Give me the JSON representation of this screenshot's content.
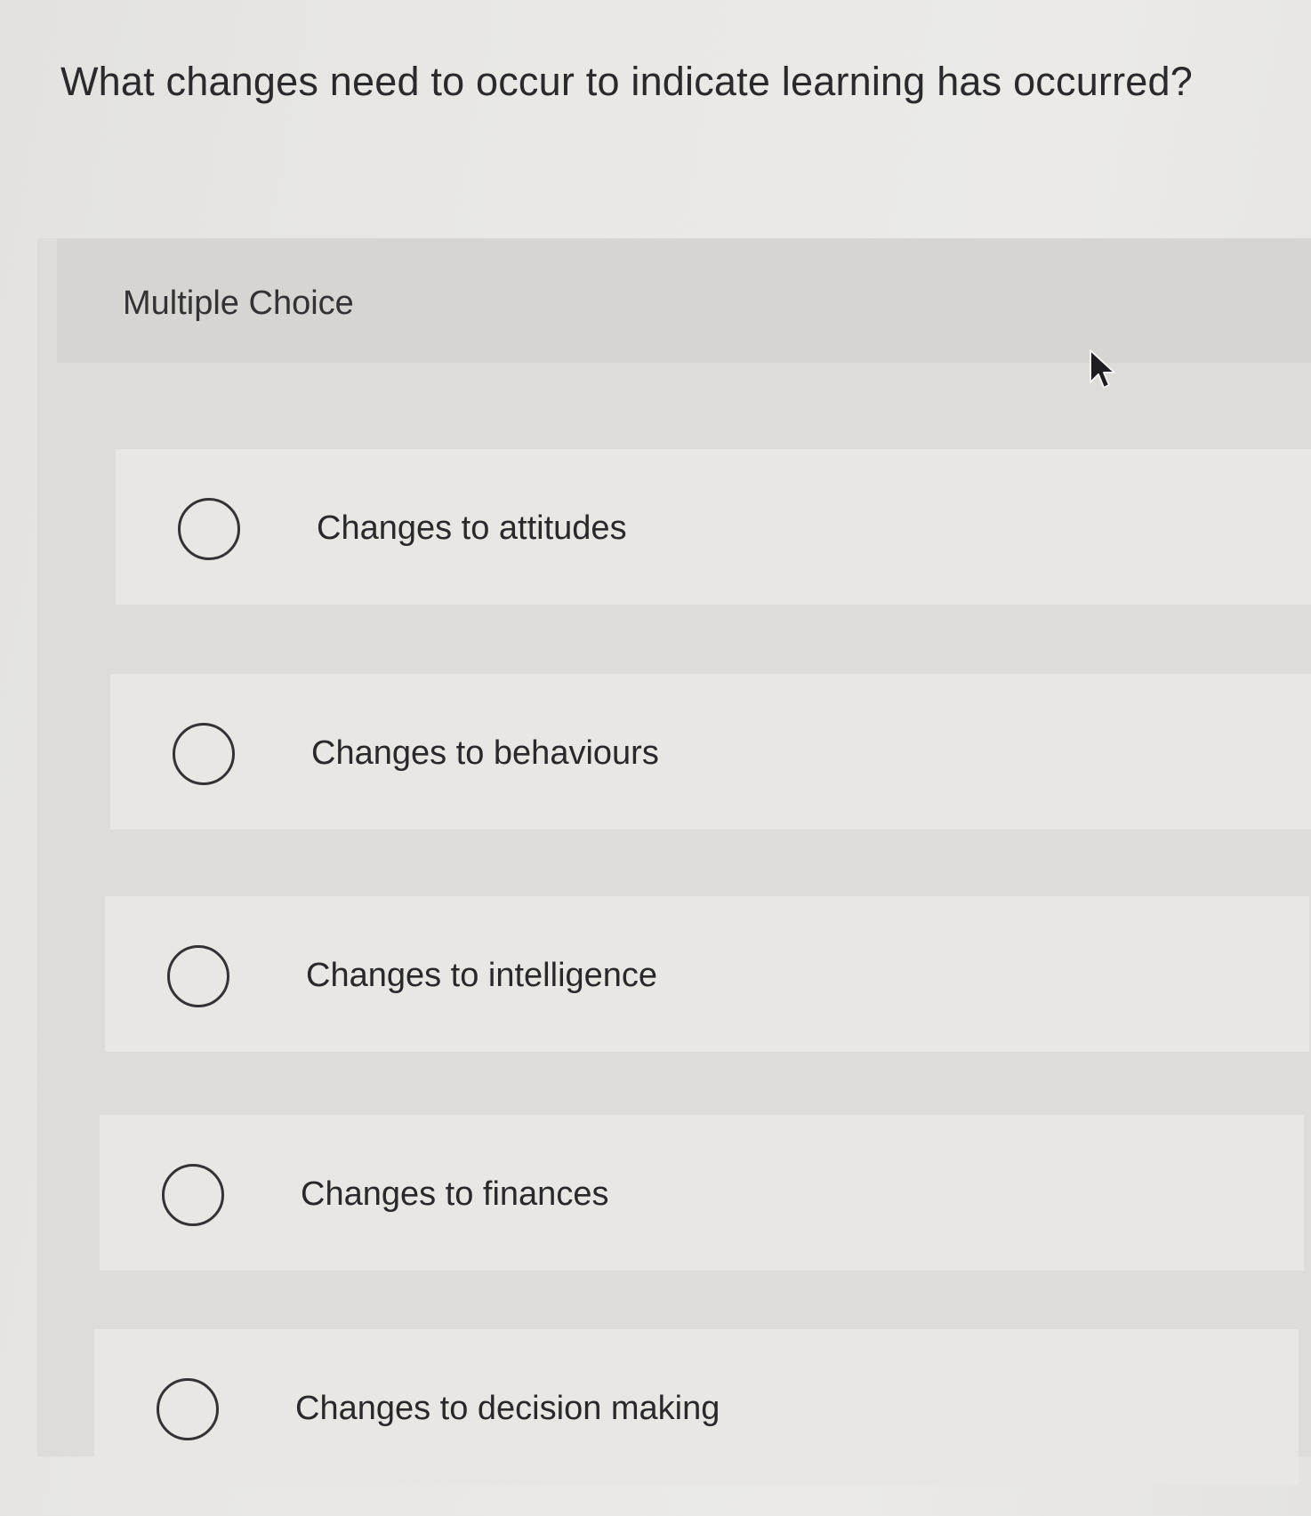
{
  "question": {
    "text": "What changes need to occur to indicate learning has occurred?"
  },
  "question_type": "Multiple Choice",
  "options": [
    {
      "label": "Changes to attitudes",
      "selected": false
    },
    {
      "label": "Changes to behaviours",
      "selected": false
    },
    {
      "label": "Changes to intelligence",
      "selected": false
    },
    {
      "label": "Changes to finances",
      "selected": false
    },
    {
      "label": "Changes to decision making",
      "selected": false
    }
  ],
  "icons": {
    "radio": "radio-unselected-icon",
    "cursor": "mouse-pointer-icon"
  },
  "colors": {
    "background": "#e8e7e4",
    "panel": "#dddcd9",
    "text": "#2a2a2c",
    "radio_border": "#333336"
  }
}
